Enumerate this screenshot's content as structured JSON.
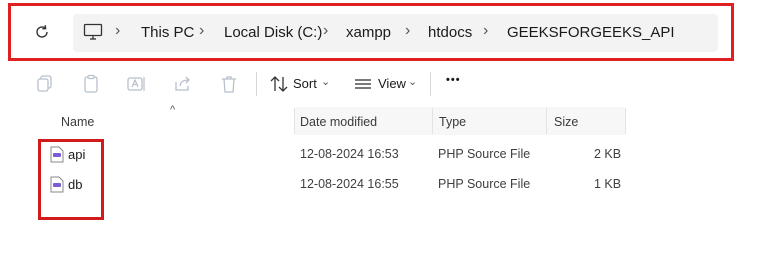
{
  "address_bar": {
    "breadcrumbs": [
      "This PC",
      "Local Disk (C:)",
      "xampp",
      "htdocs",
      "GEEKSFORGEEKS_API"
    ]
  },
  "toolbar": {
    "sort_label": "Sort",
    "view_label": "View",
    "more_label": "•••"
  },
  "columns": {
    "name": "Name",
    "date_modified": "Date modified",
    "type": "Type",
    "size": "Size"
  },
  "files": [
    {
      "name": "api",
      "date_modified": "12-08-2024 16:53",
      "type": "PHP Source File",
      "size": "2 KB"
    },
    {
      "name": "db",
      "date_modified": "12-08-2024 16:55",
      "type": "PHP Source File",
      "size": "1 KB"
    }
  ],
  "colors": {
    "highlight_outline": "#e02020",
    "file_icon_accent": "#7b5cd6"
  }
}
